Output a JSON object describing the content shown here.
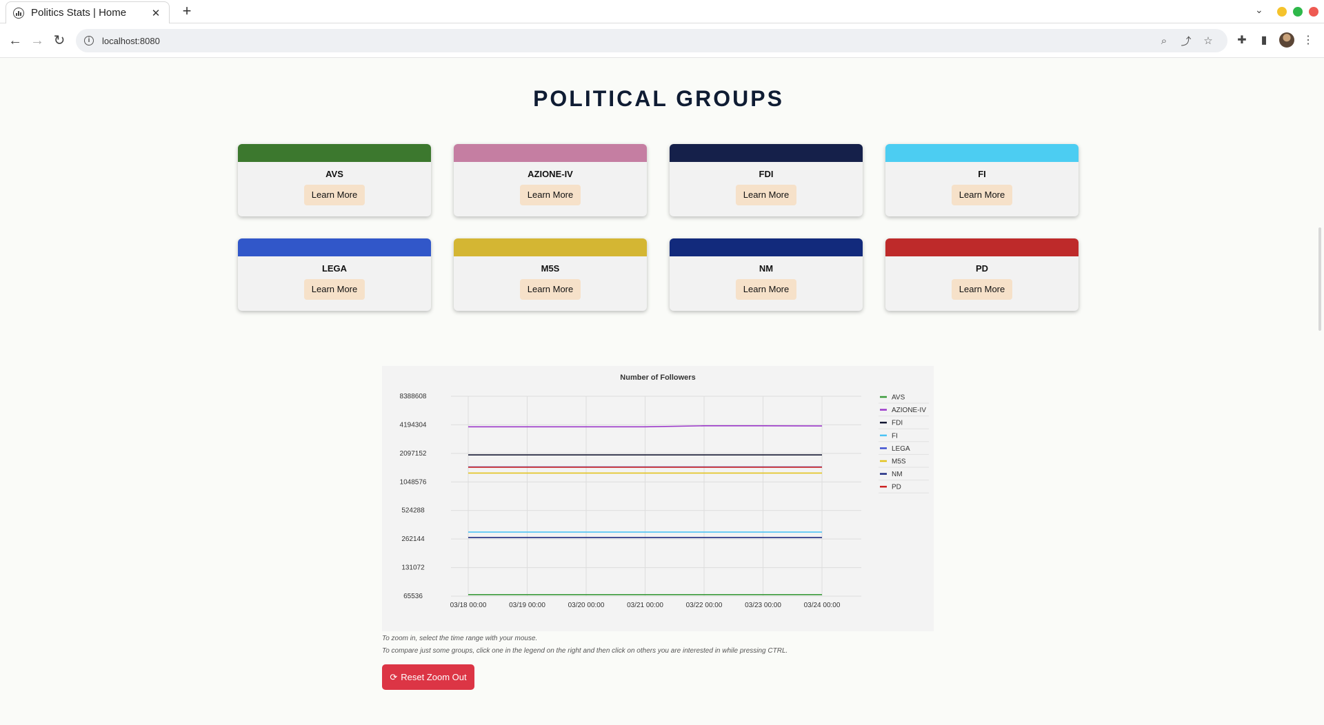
{
  "browser": {
    "tab_title": "Politics Stats | Home",
    "tab_close": "✕",
    "new_tab": "+",
    "tab_search": "⌄",
    "url": "localhost:8080",
    "window_controls": {
      "minimize": "#f5c32c",
      "maximize": "#2eb84a",
      "close": "#ee5a52"
    }
  },
  "page": {
    "heading": "POLITICAL GROUPS",
    "groups": [
      {
        "name": "AVS",
        "color": "#3c782e",
        "button": "Learn More"
      },
      {
        "name": "AZIONE-IV",
        "color": "#c57ea2",
        "button": "Learn More"
      },
      {
        "name": "FDI",
        "color": "#15204a",
        "button": "Learn More"
      },
      {
        "name": "FI",
        "color": "#4ccdf2",
        "button": "Learn More"
      },
      {
        "name": "LEGA",
        "color": "#3157c9",
        "button": "Learn More"
      },
      {
        "name": "M5S",
        "color": "#d4b633",
        "button": "Learn More"
      },
      {
        "name": "NM",
        "color": "#122a7c",
        "button": "Learn More"
      },
      {
        "name": "PD",
        "color": "#be2a2a",
        "button": "Learn More"
      }
    ],
    "hint_zoom": "To zoom in, select the time range with your mouse.",
    "hint_compare": "To compare just some groups, click one in the legend on the right and then click on others you are interested in while pressing CTRL.",
    "reset_button": "Reset Zoom Out",
    "reset_icon": "⟳"
  },
  "chart_data": {
    "type": "line",
    "title": "Number of Followers",
    "xlabel": "",
    "ylabel": "",
    "y_scale": "log2",
    "ylim": [
      65536,
      8388608
    ],
    "y_ticks": [
      "8388608",
      "4194304",
      "2097152",
      "1048576",
      "524288",
      "262144",
      "131072",
      "65536"
    ],
    "x": [
      "03/18 00:00",
      "03/19 00:00",
      "03/20 00:00",
      "03/21 00:00",
      "03/22 00:00",
      "03/23 00:00",
      "03/24 00:00"
    ],
    "grid": true,
    "legend_position": "right",
    "series": [
      {
        "name": "AVS",
        "color": "#3a9a3a",
        "values": [
          68000,
          68000,
          68000,
          68000,
          68000,
          68000,
          68000
        ]
      },
      {
        "name": "AZIONE-IV",
        "color": "#9b37c9",
        "values": [
          4000000,
          4000000,
          4000000,
          4000000,
          4100000,
          4100000,
          4080000
        ]
      },
      {
        "name": "FDI",
        "color": "#141833",
        "values": [
          2020000,
          2020000,
          2020000,
          2020000,
          2020000,
          2020000,
          2020000
        ]
      },
      {
        "name": "FI",
        "color": "#4cc3f5",
        "values": [
          310000,
          310000,
          310000,
          310000,
          310000,
          310000,
          310000
        ]
      },
      {
        "name": "LEGA",
        "color": "#3d4fd1",
        "values": [
          1510000,
          1510000,
          1510000,
          1510000,
          1510000,
          1510000,
          1510000
        ]
      },
      {
        "name": "M5S",
        "color": "#e3c31c",
        "values": [
          1300000,
          1300000,
          1300000,
          1300000,
          1300000,
          1300000,
          1300000
        ]
      },
      {
        "name": "NM",
        "color": "#1c2a80",
        "values": [
          272000,
          272000,
          272000,
          272000,
          272000,
          272000,
          272000
        ]
      },
      {
        "name": "PD",
        "color": "#cc2222",
        "values": [
          1500000,
          1500000,
          1500000,
          1500000,
          1500000,
          1500000,
          1500000
        ]
      }
    ]
  }
}
